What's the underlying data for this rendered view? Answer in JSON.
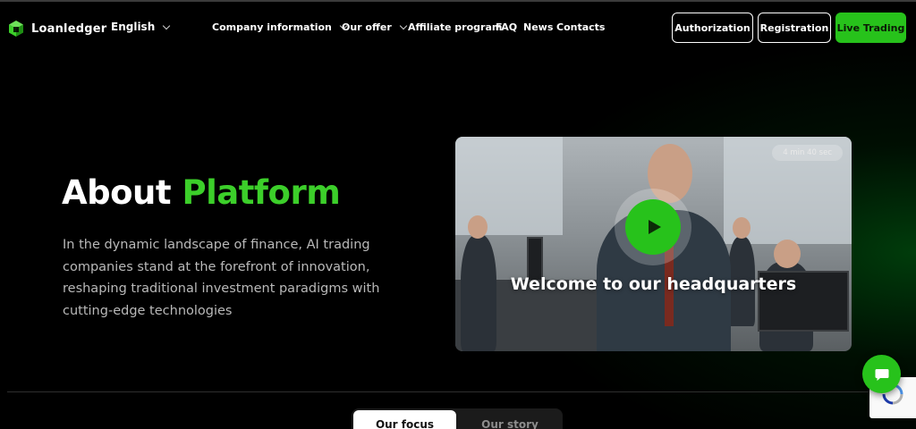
{
  "header": {
    "brand": "Loanledger",
    "language": "English",
    "nav": [
      {
        "label": "Company information",
        "dropdown": true
      },
      {
        "label": "Our offer",
        "dropdown": true
      },
      {
        "label": "Affiliate program",
        "dropdown": false
      },
      {
        "label": "FAQ",
        "dropdown": false
      },
      {
        "label": "News",
        "dropdown": false
      },
      {
        "label": "Contacts",
        "dropdown": false
      }
    ],
    "buttons": {
      "authorization": "Authorization",
      "registration": "Registration",
      "live_trading": "Live Trading"
    }
  },
  "hero": {
    "title_main": "About",
    "title_accent": "Platform",
    "description": "In the dynamic landscape of finance, AI trading companies stand at the forefront of innovation, reshaping traditional investment paradigms with cutting-edge technologies"
  },
  "video": {
    "duration": "4 min 40 sec",
    "caption": "Welcome to our headquarters"
  },
  "tabs": {
    "items": [
      "Our focus",
      "Our story"
    ],
    "active": "Our focus"
  },
  "colors": {
    "accent": "#27c21b",
    "accent_text": "#3ccf2a",
    "background": "#000000"
  },
  "icons": {
    "logo": "cube-logo-icon",
    "play": "play-icon",
    "chat": "chat-bubble-icon",
    "captcha": "recaptcha-icon"
  }
}
